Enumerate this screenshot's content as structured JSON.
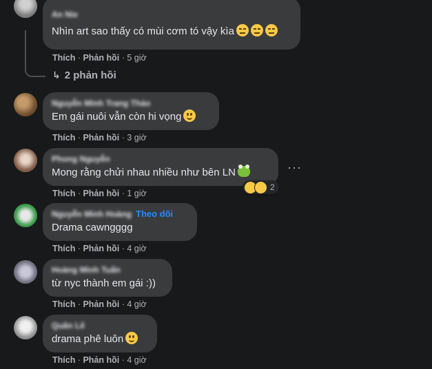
{
  "comments": [
    {
      "author": "An Nie",
      "text": "Nhìn art sao thấy có mùi cơm tó vậy kìa",
      "like_label": "Thích",
      "reply_label": "Phản hồi",
      "time": "5 giờ",
      "avatar_color": "#8a8a8a"
    },
    {
      "author": "Nguyễn Minh Trang Thảo",
      "text": "Em gái nuôi vẫn còn hi vọng",
      "like_label": "Thích",
      "reply_label": "Phản hồi",
      "time": "3 giờ",
      "avatar_color": "#7a5a3a"
    },
    {
      "author": "Phong Nguyễn",
      "text": "Mong rằng chửi nhau nhiều như bên LN",
      "like_label": "Thích",
      "reply_label": "Phản hồi",
      "time": "1 giờ",
      "reaction_count": "2",
      "avatar_color": "#9a7460"
    },
    {
      "author": "Nguyễn Minh Hoàng",
      "follow_label": "Theo dõi",
      "text": "Drama cawngggg",
      "like_label": "Thích",
      "reply_label": "Phản hồi",
      "time": "4 giờ",
      "avatar_color": "#3a8a4a"
    },
    {
      "author": "Hoàng Minh Tuấn",
      "text": "từ nyc thành em gái :))",
      "like_label": "Thích",
      "reply_label": "Phản hồi",
      "time": "4 giờ",
      "avatar_color": "#7a7a8a"
    },
    {
      "author": "Quân Lê",
      "text": "drama phê luôn",
      "like_label": "Thích",
      "reply_label": "Phản hồi",
      "time": "4 giờ",
      "avatar_color": "#9a9a9a"
    }
  ],
  "thread": {
    "replies_label": "2 phản hồi"
  },
  "colors": {
    "background": "#18191a",
    "bubble": "#3a3b3c",
    "text": "#e4e6eb",
    "secondary_text": "#b0b3b8",
    "link": "#2d88ff"
  }
}
